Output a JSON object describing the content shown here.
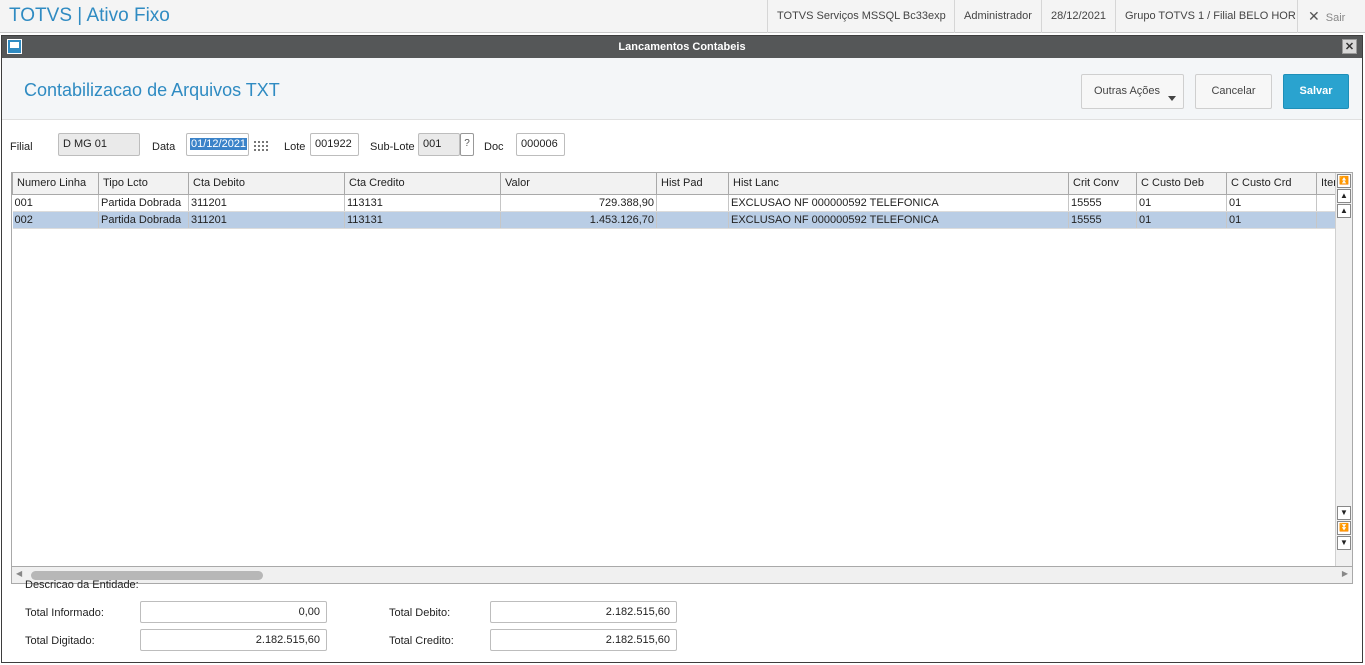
{
  "appbar": {
    "title": "TOTVS | Ativo Fixo",
    "server": "TOTVS Serviços MSSQL Bc33exp",
    "user": "Administrador",
    "date": "28/12/2021",
    "company": "Grupo TOTVS 1 / Filial BELO HOR",
    "exit_label": "Sair"
  },
  "dialog": {
    "title": "Lancamentos Contabeis",
    "heading": "Contabilizacao de Arquivos TXT",
    "buttons": {
      "other_actions": "Outras Ações",
      "cancel": "Cancelar",
      "save": "Salvar"
    }
  },
  "form": {
    "filial_label": "Filial",
    "filial_value": "D MG 01",
    "data_label": "Data",
    "data_value": "01/12/2021",
    "lote_label": "Lote",
    "lote_value": "001922",
    "sublote_label": "Sub-Lote",
    "sublote_value": "001",
    "sublote_help": "?",
    "doc_label": "Doc",
    "doc_value": "000006"
  },
  "grid": {
    "columns": [
      "Numero Linha",
      "Tipo Lcto",
      "Cta Debito",
      "Cta Credito",
      "Valor",
      "Hist Pad",
      "Hist Lanc",
      "Crit Conv",
      "C Custo Deb",
      "C Custo Crd",
      "Iten"
    ],
    "rows": [
      [
        "001",
        "Partida Dobrada",
        "311201",
        "113131",
        "729.388,90",
        "",
        "EXCLUSAO NF 000000592 TELEFONICA",
        "15555",
        "01",
        "01",
        ""
      ],
      [
        "002",
        "Partida Dobrada",
        "311201",
        "113131",
        "1.453.126,70",
        "",
        "EXCLUSAO NF 000000592 TELEFONICA",
        "15555",
        "01",
        "01",
        ""
      ]
    ],
    "selected_row": 1
  },
  "footer": {
    "entity_label": "Descricao da Entidade:",
    "total_informado_label": "Total Informado:",
    "total_informado_value": "0,00",
    "total_digitado_label": "Total Digitado:",
    "total_digitado_value": "2.182.515,60",
    "total_debito_label": "Total Debito:",
    "total_debito_value": "2.182.515,60",
    "total_credito_label": "Total Credito:",
    "total_credito_value": "2.182.515,60"
  },
  "colors": {
    "accent": "#2f8bc2",
    "save_button": "#2aa3cf",
    "title_bar": "#555758",
    "selected_row": "#b9cde5"
  }
}
